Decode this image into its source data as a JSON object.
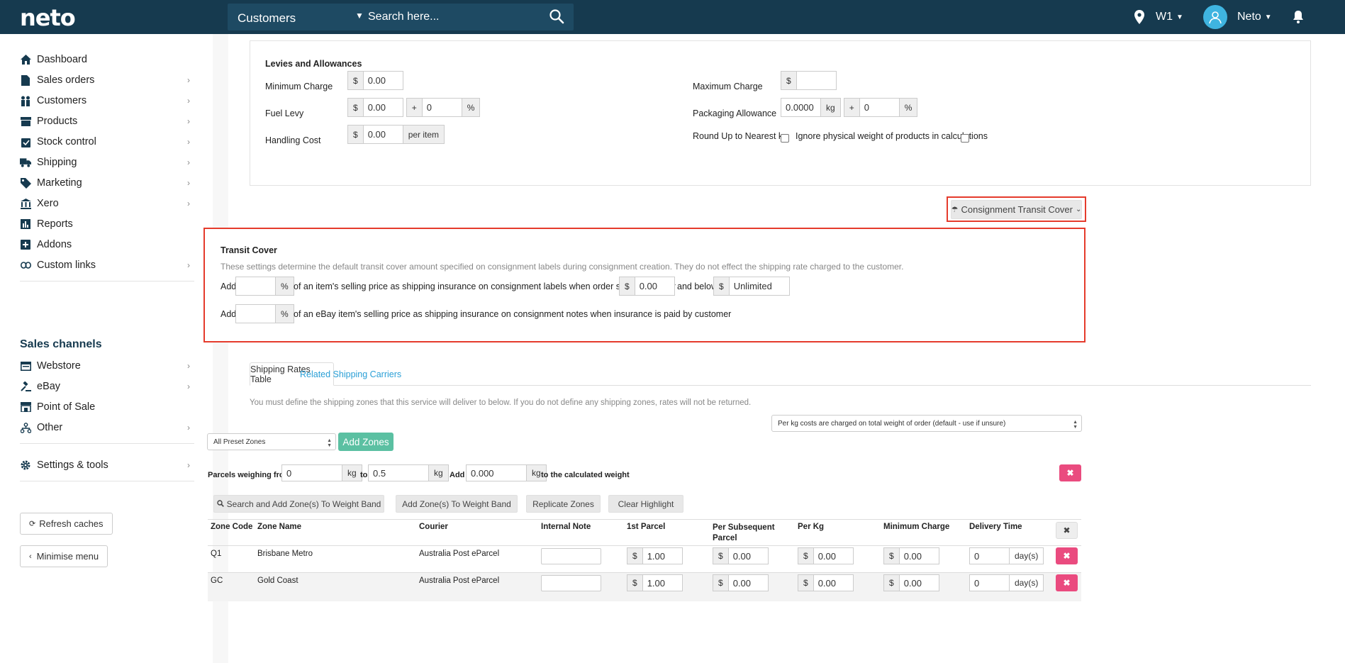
{
  "topbar": {
    "logo": "neto",
    "search_scope": "Customers",
    "search_placeholder": "Search here...",
    "location": "W1",
    "user": "Neto"
  },
  "sidebar": {
    "items": [
      {
        "label": "Dashboard",
        "icon": "home-icon"
      },
      {
        "label": "Sales orders",
        "icon": "document-icon"
      },
      {
        "label": "Customers",
        "icon": "users-icon"
      },
      {
        "label": "Products",
        "icon": "box-icon"
      },
      {
        "label": "Stock control",
        "icon": "clipboard-icon"
      },
      {
        "label": "Shipping",
        "icon": "truck-icon"
      },
      {
        "label": "Marketing",
        "icon": "tag-icon"
      },
      {
        "label": "Xero",
        "icon": "bank-icon"
      },
      {
        "label": "Reports",
        "icon": "bar-chart-icon"
      },
      {
        "label": "Addons",
        "icon": "plus-square-icon"
      },
      {
        "label": "Custom links",
        "icon": "link-icon"
      }
    ],
    "channels_heading": "Sales channels",
    "channels": [
      {
        "label": "Webstore",
        "icon": "webstore-icon"
      },
      {
        "label": "eBay",
        "icon": "gavel-icon"
      },
      {
        "label": "Point of Sale",
        "icon": "store-icon"
      },
      {
        "label": "Other",
        "icon": "sitemap-icon"
      }
    ],
    "settings": "Settings & tools",
    "refresh": "Refresh caches",
    "minimise": "Minimise menu"
  },
  "levies": {
    "title": "Levies and Allowances",
    "min_charge_label": "Minimum Charge",
    "currency": "$",
    "min_charge": "0.00",
    "max_charge_label": "Maximum Charge",
    "max_charge": "",
    "fuel_levy_label": "Fuel Levy",
    "fuel_levy": "0.00",
    "plus": "+",
    "fuel_pct": "0",
    "pct": "%",
    "packaging_label": "Packaging Allowance",
    "packaging_kg": "0.0000",
    "kg": "kg",
    "packaging_pct": "0",
    "handling_label": "Handling Cost",
    "handling": "0.00",
    "per_item": "per item",
    "round_up_label": "Round Up to Nearest kg",
    "ignore_label": "Ignore physical weight of products in calculations"
  },
  "consignment_button": "Consignment Transit Cover",
  "transit": {
    "title": "Transit Cover",
    "desc": "These settings determine the default transit cover amount specified on consignment labels during consignment creation. They do not effect the shipping rate charged to the customer.",
    "add": "Add",
    "row1_text": "of an item's selling price as shipping insurance on consignment labels when order subtotal is over",
    "over_value": "0.00",
    "and_below": "and below",
    "below_value": "Unlimited",
    "row2_text": "of an eBay item's selling price as shipping insurance on consignment notes when insurance is paid by customer"
  },
  "tabs": {
    "active": "Shipping Rates Table",
    "other": "Related Shipping Carriers"
  },
  "rates": {
    "note": "You must define the shipping zones that this service will deliver to below. If you do not define any shipping zones, rates will not be returned.",
    "per_kg_select": "Per kg costs are charged on total weight of order (default - use if unsure)",
    "preset_select": "All Preset Zones",
    "add_zones": "Add Zones",
    "parcels_from": "Parcels weighing from",
    "from_value": "0",
    "to": "to",
    "to_value": "0.5",
    "add": "Add",
    "add_value": "0.000",
    "calc_weight": "to the calculated weight",
    "btn_search": "Search and Add Zone(s) To Weight Band",
    "btn_add_zone": "Add Zone(s) To Weight Band",
    "btn_replicate": "Replicate Zones",
    "btn_clear": "Clear Highlight",
    "columns": [
      "Zone Code",
      "Zone Name",
      "Courier",
      "Internal Note",
      "1st Parcel",
      "Per Subsequent Parcel",
      "Per Kg",
      "Minimum Charge",
      "Delivery Time"
    ],
    "day_unit": "day(s)",
    "rows": [
      {
        "code": "Q1",
        "name": "Brisbane Metro",
        "courier": "Australia Post eParcel",
        "note": "",
        "first": "1.00",
        "subsequent": "0.00",
        "per_kg": "0.00",
        "min": "0.00",
        "days": "0"
      },
      {
        "code": "GC",
        "name": "Gold Coast",
        "courier": "Australia Post eParcel",
        "note": "",
        "first": "1.00",
        "subsequent": "0.00",
        "per_kg": "0.00",
        "min": "0.00",
        "days": "0"
      }
    ]
  }
}
